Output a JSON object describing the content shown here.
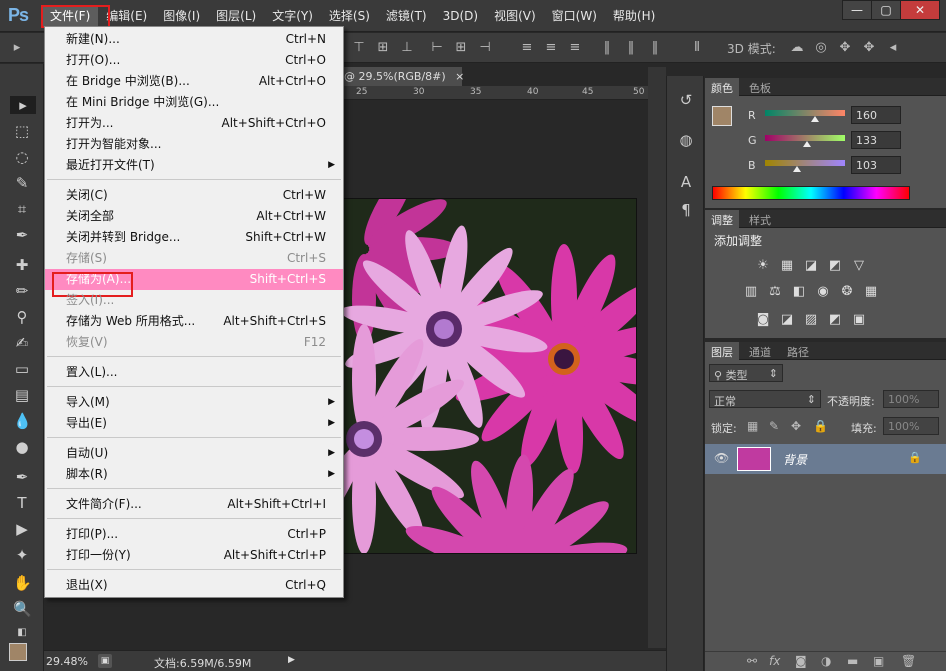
{
  "app": {
    "logo": "Ps"
  },
  "menubar": {
    "items": [
      "文件(F)",
      "编辑(E)",
      "图像(I)",
      "图层(L)",
      "文字(Y)",
      "选择(S)",
      "滤镜(T)",
      "3D(D)",
      "视图(V)",
      "窗口(W)",
      "帮助(H)"
    ]
  },
  "window_controls": {
    "minimize": "—",
    "restore": "▢",
    "close": "✕"
  },
  "options_bar": {
    "label_3d_mode": "3D 模式:"
  },
  "document": {
    "tab_label": "@ 29.5%(RGB/8#)",
    "tab_close": "×",
    "ruler_ticks": [
      "25",
      "30",
      "35",
      "40",
      "45",
      "50"
    ]
  },
  "file_menu": {
    "items": [
      {
        "label": "新建(N)...",
        "shortcut": "Ctrl+N"
      },
      {
        "label": "打开(O)...",
        "shortcut": "Ctrl+O"
      },
      {
        "label": "在 Bridge 中浏览(B)...",
        "shortcut": "Alt+Ctrl+O"
      },
      {
        "label": "在 Mini Bridge 中浏览(G)...",
        "shortcut": ""
      },
      {
        "label": "打开为...",
        "shortcut": "Alt+Shift+Ctrl+O"
      },
      {
        "label": "打开为智能对象...",
        "shortcut": ""
      },
      {
        "label": "最近打开文件(T)",
        "shortcut": "",
        "submenu": true
      },
      {
        "label": "关闭(C)",
        "shortcut": "Ctrl+W"
      },
      {
        "label": "关闭全部",
        "shortcut": "Alt+Ctrl+W"
      },
      {
        "label": "关闭并转到 Bridge...",
        "shortcut": "Shift+Ctrl+W"
      },
      {
        "label": "存储(S)",
        "shortcut": "Ctrl+S",
        "disabled": true
      },
      {
        "label": "存储为(A)...",
        "shortcut": "Shift+Ctrl+S",
        "highlighted": true
      },
      {
        "label": "签入(I)...",
        "shortcut": "",
        "disabled": true
      },
      {
        "label": "存储为 Web 所用格式...",
        "shortcut": "Alt+Shift+Ctrl+S"
      },
      {
        "label": "恢复(V)",
        "shortcut": "F12",
        "disabled": true
      },
      {
        "label": "置入(L)...",
        "shortcut": ""
      },
      {
        "label": "导入(M)",
        "shortcut": "",
        "submenu": true
      },
      {
        "label": "导出(E)",
        "shortcut": "",
        "submenu": true
      },
      {
        "label": "自动(U)",
        "shortcut": "",
        "submenu": true
      },
      {
        "label": "脚本(R)",
        "shortcut": "",
        "submenu": true
      },
      {
        "label": "文件简介(F)...",
        "shortcut": "Alt+Shift+Ctrl+I"
      },
      {
        "label": "打印(P)...",
        "shortcut": "Ctrl+P"
      },
      {
        "label": "打印一份(Y)",
        "shortcut": "Alt+Shift+Ctrl+P"
      },
      {
        "label": "退出(X)",
        "shortcut": "Ctrl+Q"
      }
    ]
  },
  "color_panel": {
    "tabs": [
      "颜色",
      "色板"
    ],
    "swatch_color": "#a08567",
    "channels": [
      {
        "name": "R",
        "value": "160"
      },
      {
        "name": "G",
        "value": "133"
      },
      {
        "name": "B",
        "value": "103"
      }
    ]
  },
  "adjustments_panel": {
    "tabs": [
      "调整",
      "样式"
    ],
    "title": "添加调整"
  },
  "layers_panel": {
    "tabs": [
      "图层",
      "通道",
      "路径"
    ],
    "filter_label": "类型",
    "blend_mode": "正常",
    "opacity_label": "不透明度:",
    "opacity_value": "100%",
    "lock_label": "锁定:",
    "fill_label": "填充:",
    "fill_value": "100%",
    "layer_name": "背景"
  },
  "status_bar": {
    "zoom": "29.48%",
    "doc_info": "文档:6.59M/6.59M"
  },
  "colors": {
    "menu_highlight": "#ff8ac1",
    "annotation_box": "#e41e1e",
    "foreground_color": "#a08567"
  }
}
